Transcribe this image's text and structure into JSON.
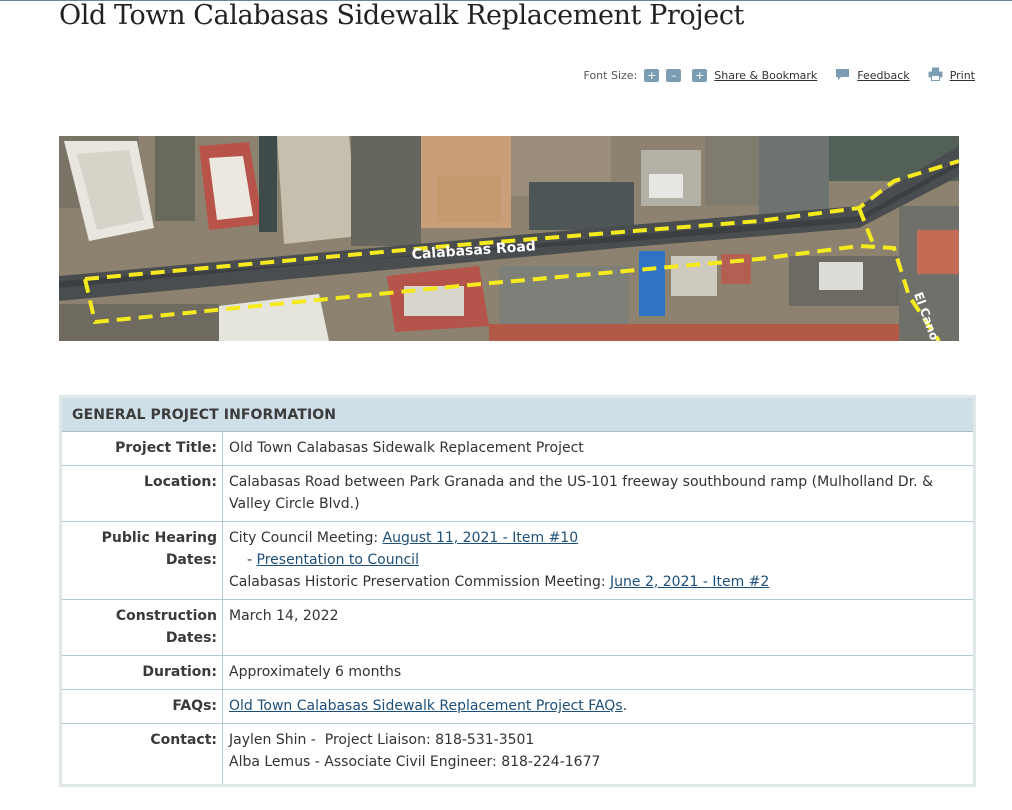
{
  "page": {
    "title": "Old Town Calabasas Sidewalk Replacement Project"
  },
  "toolbar": {
    "font_size_label": "Font Size:",
    "increase_symbol": "+",
    "decrease_symbol": "–",
    "share_symbol": "+",
    "share_label": "Share & Bookmark",
    "feedback_label": "Feedback",
    "print_label": "Print"
  },
  "map": {
    "road_label": "Calabasas Road",
    "side_road_label": "El Canon",
    "boundary_color": "#f5ea1e"
  },
  "info": {
    "heading": "GENERAL PROJECT INFORMATION",
    "rows": {
      "title": {
        "key": "Project Title:",
        "value": "Old Town Calabasas Sidewalk Replacement Project"
      },
      "location": {
        "key": "Location:",
        "value": "Calabasas Road between Park Granada and the US-101 freeway southbound ramp (Mulholland Dr. & Valley Circle Blvd.)"
      },
      "hearing": {
        "key": "Public Hearing Dates:",
        "line1_prefix": "City Council Meeting: ",
        "line1_link": "August 11, 2021 - Item #10",
        "line2_prefix": "- ",
        "line2_link": "Presentation to Council",
        "line3_prefix": "Calabasas Historic Preservation Commission Meeting: ",
        "line3_link": "June 2, 2021 - Item #2"
      },
      "construction": {
        "key": "Construction Dates:",
        "value": "March 14, 2022"
      },
      "duration": {
        "key": "Duration:",
        "value": "Approximately 6 months"
      },
      "faqs": {
        "key": "FAQs:",
        "link": "Old Town Calabasas Sidewalk Replacement Project FAQs",
        "suffix": "."
      },
      "contact": {
        "key": "Contact:",
        "line1": "Jaylen Shin -  Project Liaison: 818-531-3501",
        "line2": "Alba Lemus - Associate Civil Engineer: 818-224-1677"
      }
    }
  },
  "colors": {
    "accent_link": "#1e4f78",
    "header_bg": "#cfdfe7",
    "tool_button": "#7a9db4"
  }
}
